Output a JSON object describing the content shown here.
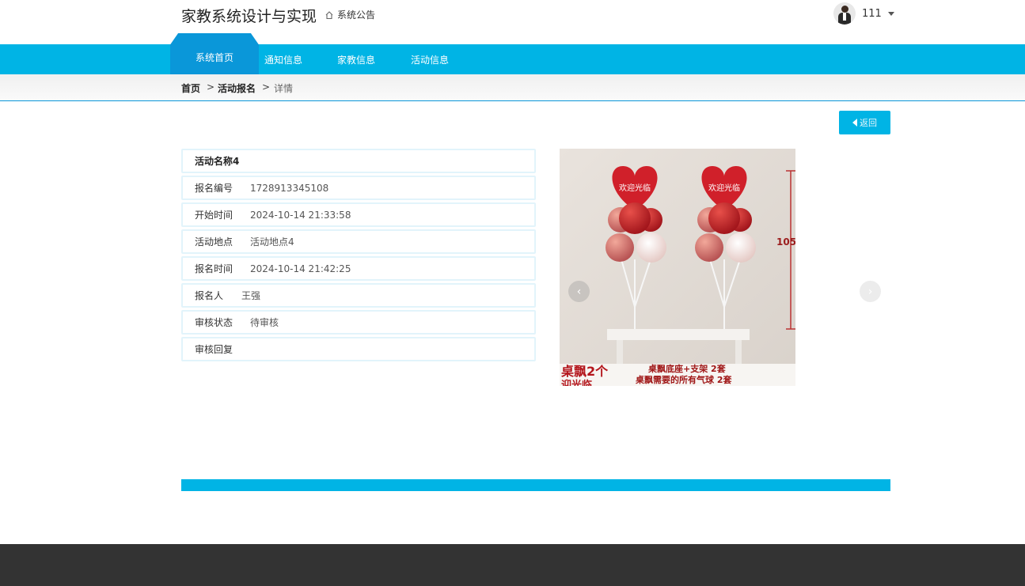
{
  "header": {
    "site_title": "家教系统设计与实现",
    "notice_label": "系统公告",
    "user_name": "111"
  },
  "nav": {
    "items": [
      {
        "label": "系统首页",
        "active": true
      },
      {
        "label": "通知信息"
      },
      {
        "label": "家教信息"
      },
      {
        "label": "活动信息"
      }
    ]
  },
  "breadcrumb": {
    "home": "首页",
    "sep": ">",
    "section": "活动报名",
    "current": "详情"
  },
  "back_button": {
    "label": "返回"
  },
  "detail": {
    "title": "活动名称4",
    "rows": [
      {
        "label": "报名编号",
        "value": "1728913345108"
      },
      {
        "label": "开始时间",
        "value": "2024-10-14 21:33:58"
      },
      {
        "label": "活动地点",
        "value": "活动地点4"
      },
      {
        "label": "报名时间",
        "value": "2024-10-14 21:42:25"
      },
      {
        "label": "报名人",
        "value": "王强"
      },
      {
        "label": "审核状态",
        "value": "待审核"
      },
      {
        "label": "审核回复",
        "value": ""
      }
    ]
  },
  "image": {
    "balloon_text": "欢迎光临",
    "size_label": "105",
    "caption_left": "桌飘2个",
    "caption_left_sub": "迎光临",
    "caption_right_1": "桌飘底座+支架 2套",
    "caption_right_2": "桌飘需要的所有气球 2套"
  },
  "colors": {
    "accent": "#00b4e5",
    "accent_dark": "#0a97d9",
    "footer": "#333333"
  }
}
